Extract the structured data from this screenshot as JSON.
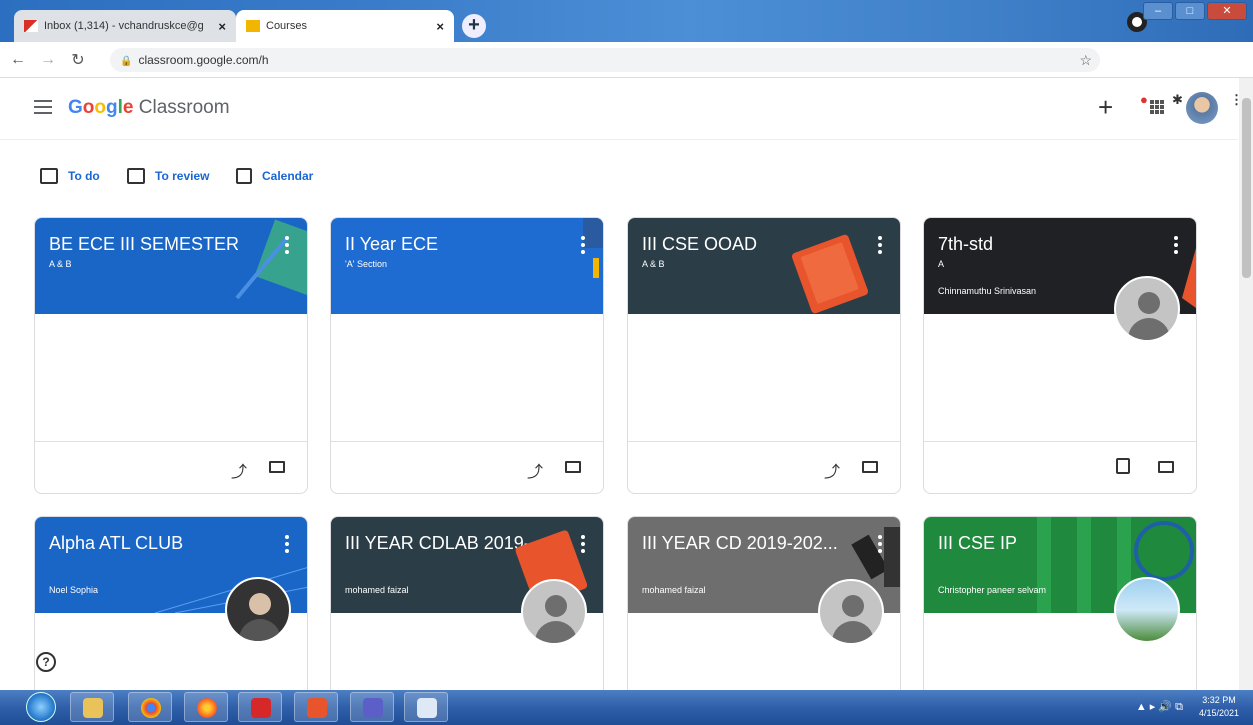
{
  "browser": {
    "tabs": [
      {
        "title": "Inbox (1,314) - vchandruskce@g",
        "favicon": "gmail-icon"
      },
      {
        "title": "Courses",
        "favicon": "classroom-icon"
      }
    ],
    "url": "classroom.google.com/h"
  },
  "app": {
    "logo_google": "Google",
    "logo_product": "Classroom"
  },
  "quick_links": {
    "todo": "To do",
    "review": "To review",
    "calendar": "Calendar"
  },
  "courses": [
    {
      "title": "BE ECE III SEMESTER",
      "section": "A & B",
      "teacher": "",
      "color": "#1a66c6"
    },
    {
      "title": "II Year ECE",
      "section": "'A' Section",
      "teacher": "",
      "color": "#1e6bd1"
    },
    {
      "title": "III CSE OOAD",
      "section": "A & B",
      "teacher": "",
      "color": "#2b3e47"
    },
    {
      "title": "7th-std",
      "section": "A",
      "teacher": "Chinnamuthu Srinivasan",
      "color": "#202124"
    },
    {
      "title": "Alpha ATL CLUB",
      "section": "",
      "teacher": "Noel Sophia",
      "color": "#1a66c6"
    },
    {
      "title": "III YEAR CDLAB 2019-...",
      "section": "",
      "teacher": "mohamed faizal",
      "color": "#2b3e47"
    },
    {
      "title": "III YEAR CD 2019-202...",
      "section": "",
      "teacher": "mohamed faizal",
      "color": "#6e6e6e"
    },
    {
      "title": "III CSE IP",
      "section": "",
      "teacher": "Christopher paneer selvam",
      "color": "#1f8a3d"
    }
  ],
  "taskbar": {
    "time": "3:32 PM",
    "date": "4/15/2021"
  }
}
